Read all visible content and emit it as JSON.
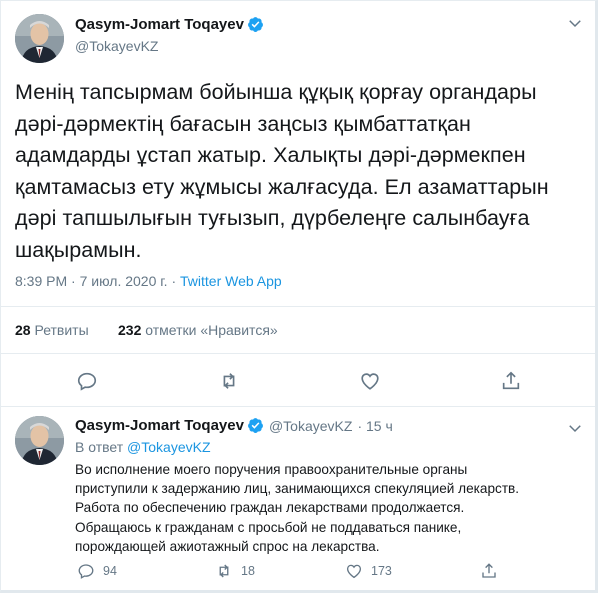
{
  "main_tweet": {
    "author_name": "Qasym-Jomart Toqayev",
    "author_handle": "@TokayevKZ",
    "text_lines": [
      "Менің тапсырмам бойынша құқық қорғау органдары",
      "дәрі-дәрмектің бағасын заңсыз қымбаттатқан",
      "адамдарды ұстап жатыр. Халықты дәрі-дәрмекпен",
      "қамтамасыз ету жұмысы жалғасуда. Ел азаматтарын",
      "дәрі тапшылығын туғызып, дүрбелеңге салынбауға",
      "шақырамын."
    ],
    "time": "8:39 PM",
    "date": "7 июл. 2020 г.",
    "separator": "·",
    "app": "Twitter Web App",
    "retweets_count": "28",
    "retweets_label": "Ретвиты",
    "likes_count": "232",
    "likes_label": "отметки «Нравится»"
  },
  "reply_tweet": {
    "author_name": "Qasym-Jomart Toqayev",
    "author_handle": "@TokayevKZ",
    "time_ago": "· 15 ч",
    "reply_prefix": "В ответ",
    "reply_to": "@TokayevKZ",
    "text_lines": [
      "Во исполнение моего поручения правоохранительные органы",
      "приступили к задержанию лиц, занимающихся спекуляцией лекарств.",
      "Работа по обеспечению граждан лекарствами продолжается.",
      "Обращаюсь к гражданам с просьбой не поддаваться панике,",
      "порождающей ажиотажный спрос на лекарства."
    ],
    "replies": "94",
    "retweets": "18",
    "likes": "173"
  },
  "icons": {
    "verified": "verified-badge-icon",
    "chevron": "chevron-down-icon",
    "reply": "reply-icon",
    "retweet": "retweet-icon",
    "like": "like-icon",
    "share": "share-icon"
  },
  "colors": {
    "link": "#1b95e0",
    "muted": "#657786",
    "text": "#14171a",
    "verified": "#1da1f2"
  }
}
